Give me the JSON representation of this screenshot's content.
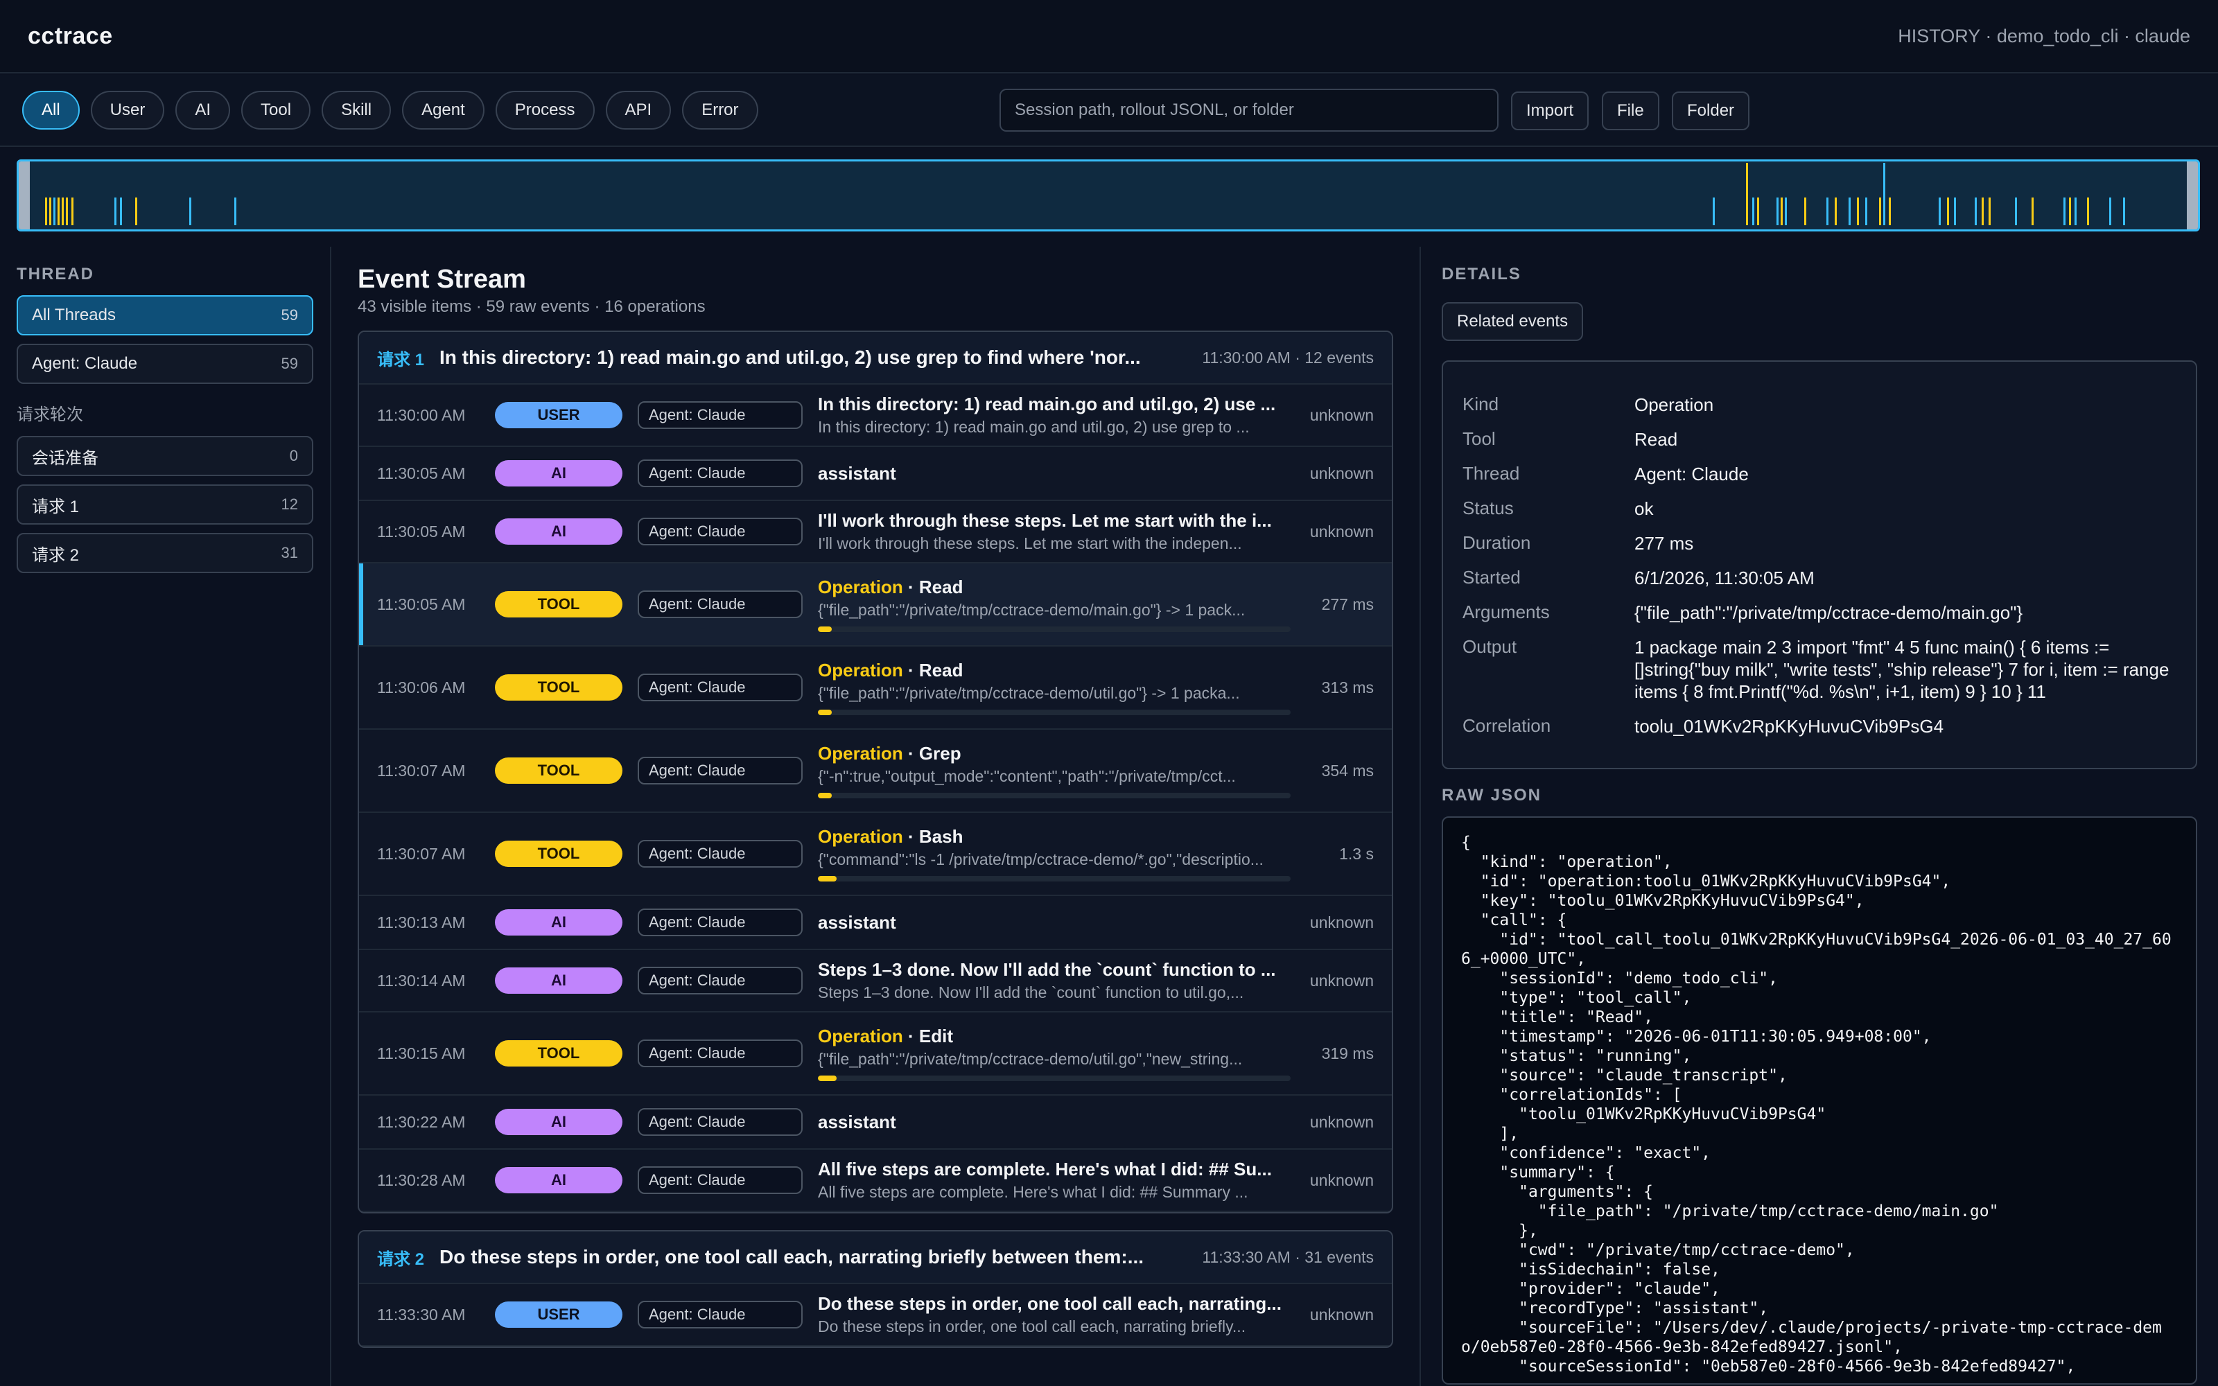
{
  "app": {
    "brand": "cctrace",
    "session_info": "HISTORY · demo_todo_cli · claude"
  },
  "filters": {
    "chips": [
      "All",
      "User",
      "AI",
      "Tool",
      "Skill",
      "Agent",
      "Process",
      "API",
      "Error"
    ],
    "active": "All",
    "search_placeholder": "Session path, rollout JSONL, or folder",
    "import_label": "Import",
    "file_label": "File",
    "folder_label": "Folder"
  },
  "colors": {
    "accent": "#38bdf8",
    "user": "#60a5fa",
    "ai": "#c084fc",
    "tool": "#facc15"
  },
  "sidebar": {
    "thread_title": "THREAD",
    "threads": [
      {
        "label": "All Threads",
        "count": "59"
      },
      {
        "label": "Agent: Claude",
        "count": "59"
      }
    ],
    "rounds_title": "请求轮次",
    "rounds": [
      {
        "label": "会话准备",
        "count": "0"
      },
      {
        "label": "请求 1",
        "count": "12"
      },
      {
        "label": "请求 2",
        "count": "31"
      }
    ]
  },
  "stream": {
    "title": "Event Stream",
    "subtitle": "43 visible items · 59 raw events · 16 operations",
    "groups": [
      {
        "tag": "请求 1",
        "title": "In this directory: 1) read main.go and util.go, 2) use grep to find where 'nor...",
        "meta": "11:30:00 AM · 12 events",
        "rows": [
          {
            "time": "11:30:00 AM",
            "kind": "user",
            "badge": "USER",
            "agent": "Agent: Claude",
            "title": "In this directory: 1) read main.go and util.go, 2) use ...",
            "sub": "In this directory: 1) read main.go and util.go, 2) use grep to ...",
            "dur": "unknown"
          },
          {
            "time": "11:30:05 AM",
            "kind": "ai",
            "badge": "AI",
            "agent": "Agent: Claude",
            "title": "assistant",
            "sub": "",
            "dur": "unknown"
          },
          {
            "time": "11:30:05 AM",
            "kind": "ai",
            "badge": "AI",
            "agent": "Agent: Claude",
            "title": "I'll work through these steps. Let me start with the i...",
            "sub": "I'll work through these steps. Let me start with the indepen...",
            "dur": "unknown"
          },
          {
            "time": "11:30:05 AM",
            "kind": "tool",
            "badge": "TOOL",
            "agent": "Agent: Claude",
            "op": "Operation",
            "title": " · Read",
            "sub": "{\"file_path\":\"/private/tmp/cctrace-demo/main.go\"} -> 1 pack...",
            "dur": "277 ms",
            "progress": 0.03,
            "selected": true
          },
          {
            "time": "11:30:06 AM",
            "kind": "tool",
            "badge": "TOOL",
            "agent": "Agent: Claude",
            "op": "Operation",
            "title": " · Read",
            "sub": "{\"file_path\":\"/private/tmp/cctrace-demo/util.go\"} -> 1 packa...",
            "dur": "313 ms",
            "progress": 0.03
          },
          {
            "time": "11:30:07 AM",
            "kind": "tool",
            "badge": "TOOL",
            "agent": "Agent: Claude",
            "op": "Operation",
            "title": " · Grep",
            "sub": "{\"-n\":true,\"output_mode\":\"content\",\"path\":\"/private/tmp/cct...",
            "dur": "354 ms",
            "progress": 0.03
          },
          {
            "time": "11:30:07 AM",
            "kind": "tool",
            "badge": "TOOL",
            "agent": "Agent: Claude",
            "op": "Operation",
            "title": " · Bash",
            "sub": "{\"command\":\"ls -1 /private/tmp/cctrace-demo/*.go\",\"descriptio...",
            "dur": "1.3 s",
            "progress": 0.04
          },
          {
            "time": "11:30:13 AM",
            "kind": "ai",
            "badge": "AI",
            "agent": "Agent: Claude",
            "title": "assistant",
            "sub": "",
            "dur": "unknown"
          },
          {
            "time": "11:30:14 AM",
            "kind": "ai",
            "badge": "AI",
            "agent": "Agent: Claude",
            "title": "Steps 1–3 done. Now I'll add the `count` function to ...",
            "sub": "Steps 1–3 done. Now I'll add the `count` function to util.go,...",
            "dur": "unknown"
          },
          {
            "time": "11:30:15 AM",
            "kind": "tool",
            "badge": "TOOL",
            "agent": "Agent: Claude",
            "op": "Operation",
            "title": " · Edit",
            "sub": "{\"file_path\":\"/private/tmp/cctrace-demo/util.go\",\"new_string...",
            "dur": "319 ms",
            "progress": 0.04
          },
          {
            "time": "11:30:22 AM",
            "kind": "ai",
            "badge": "AI",
            "agent": "Agent: Claude",
            "title": "assistant",
            "sub": "",
            "dur": "unknown"
          },
          {
            "time": "11:30:28 AM",
            "kind": "ai",
            "badge": "AI",
            "agent": "Agent: Claude",
            "title": "All five steps are complete. Here's what I did: ## Su...",
            "sub": "All five steps are complete. Here's what I did: ## Summary ...",
            "dur": "unknown"
          }
        ]
      },
      {
        "tag": "请求 2",
        "title": "Do these steps in order, one tool call each, narrating briefly between them:...",
        "meta": "11:33:30 AM · 31 events",
        "rows": [
          {
            "time": "11:33:30 AM",
            "kind": "user",
            "badge": "USER",
            "agent": "Agent: Claude",
            "title": "Do these steps in order, one tool call each, narrating...",
            "sub": "Do these steps in order, one tool call each, narrating briefly...",
            "dur": "unknown"
          }
        ]
      }
    ]
  },
  "details": {
    "title": "DETAILS",
    "related_label": "Related events",
    "fields": [
      {
        "k": "Kind",
        "v": "Operation"
      },
      {
        "k": "Tool",
        "v": "Read"
      },
      {
        "k": "Thread",
        "v": "Agent: Claude"
      },
      {
        "k": "Status",
        "v": "ok"
      },
      {
        "k": "Duration",
        "v": "277 ms"
      },
      {
        "k": "Started",
        "v": "6/1/2026, 11:30:05 AM"
      },
      {
        "k": "Arguments",
        "v": "{\"file_path\":\"/private/tmp/cctrace-demo/main.go\"}"
      },
      {
        "k": "Output",
        "v": "1 package main 2 3 import \"fmt\" 4 5 func main() { 6 items := []string{\"buy milk\", \"write tests\", \"ship release\"} 7 for i, item := range items { 8 fmt.Printf(\"%d. %s\\n\", i+1, item) 9 } 10 } 11"
      },
      {
        "k": "Correlation",
        "v": "toolu_01WKv2RpKKyHuvuCVib9PsG4"
      }
    ],
    "raw_title": "RAW JSON",
    "raw_json": "{\n  \"kind\": \"operation\",\n  \"id\": \"operation:toolu_01WKv2RpKKyHuvuCVib9PsG4\",\n  \"key\": \"toolu_01WKv2RpKKyHuvuCVib9PsG4\",\n  \"call\": {\n    \"id\": \"tool_call_toolu_01WKv2RpKKyHuvuCVib9PsG4_2026-06-01_03_40_27_606_+0000_UTC\",\n    \"sessionId\": \"demo_todo_cli\",\n    \"type\": \"tool_call\",\n    \"title\": \"Read\",\n    \"timestamp\": \"2026-06-01T11:30:05.949+08:00\",\n    \"status\": \"running\",\n    \"source\": \"claude_transcript\",\n    \"correlationIds\": [\n      \"toolu_01WKv2RpKKyHuvuCVib9PsG4\"\n    ],\n    \"confidence\": \"exact\",\n    \"summary\": {\n      \"arguments\": {\n        \"file_path\": \"/private/tmp/cctrace-demo/main.go\"\n      },\n      \"cwd\": \"/private/tmp/cctrace-demo\",\n      \"isSidechain\": false,\n      \"provider\": \"claude\",\n      \"recordType\": \"assistant\",\n      \"sourceFile\": \"/Users/dev/.claude/projects/-private-tmp-cctrace-demo/0eb587e0-28f0-4566-9e3b-842efed89427.jsonl\",\n      \"sourceSessionId\": \"0eb587e0-28f0-4566-9e3b-842efed89427\","
  }
}
